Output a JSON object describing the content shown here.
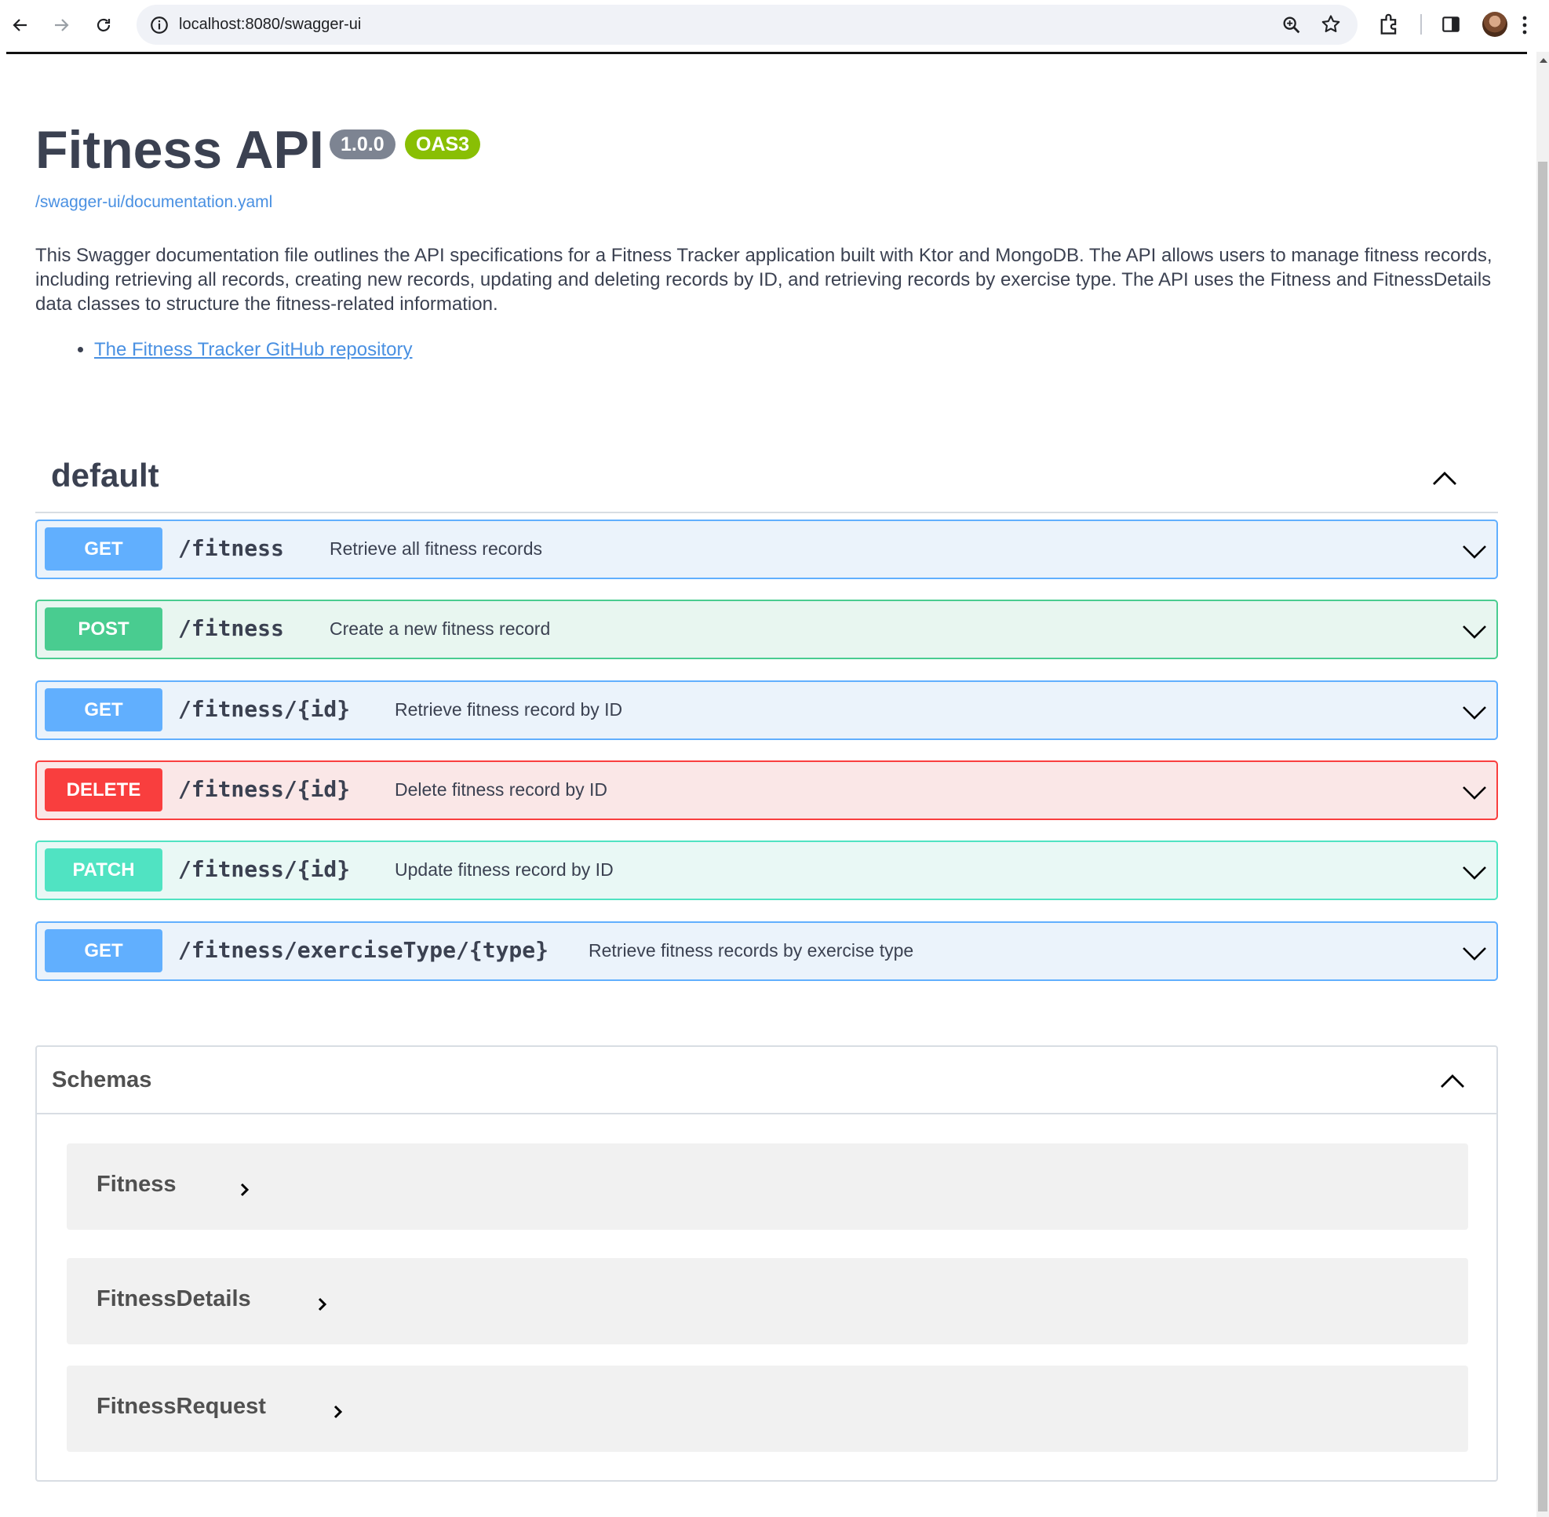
{
  "browser": {
    "url": "localhost:8080/swagger-ui"
  },
  "info": {
    "title": "Fitness API",
    "version_badge": "1.0.0",
    "oas_badge": "OAS3",
    "spec_link": "/swagger-ui/documentation.yaml",
    "description": "This Swagger documentation file outlines the API specifications for a Fitness Tracker application built with Ktor and MongoDB. The API allows users to manage fitness records, including retrieving all records, creating new records, updating and deleting records by ID, and retrieving records by exercise type. The API uses the Fitness and FitnessDetails data classes to structure the fitness-related information.",
    "links": [
      "The Fitness Tracker GitHub repository"
    ]
  },
  "tag": {
    "name": "default",
    "operations": [
      {
        "method": "GET",
        "path": "/fitness",
        "summary": "Retrieve all fitness records"
      },
      {
        "method": "POST",
        "path": "/fitness",
        "summary": "Create a new fitness record"
      },
      {
        "method": "GET",
        "path": "/fitness/{id}",
        "summary": "Retrieve fitness record by ID"
      },
      {
        "method": "DELETE",
        "path": "/fitness/{id}",
        "summary": "Delete fitness record by ID"
      },
      {
        "method": "PATCH",
        "path": "/fitness/{id}",
        "summary": "Update fitness record by ID"
      },
      {
        "method": "GET",
        "path": "/fitness/exerciseType/{type}",
        "summary": "Retrieve fitness records by exercise type"
      }
    ]
  },
  "schemas": {
    "title": "Schemas",
    "models": [
      "Fitness",
      "FitnessDetails",
      "FitnessRequest"
    ]
  },
  "colors": {
    "get": "#61affe",
    "post": "#49cc90",
    "delete": "#f93e3e",
    "patch": "#50e3c2",
    "link": "#4990e2",
    "version_badge": "#7d8492",
    "oas_badge": "#89bf04"
  },
  "icons": [
    "back-arrow-icon",
    "forward-arrow-icon",
    "reload-icon",
    "info-icon",
    "zoom-icon",
    "star-icon",
    "extensions-icon",
    "side-panel-icon",
    "kebab-menu-icon",
    "chevron-up-icon",
    "chevron-down-icon",
    "chevron-right-icon"
  ]
}
